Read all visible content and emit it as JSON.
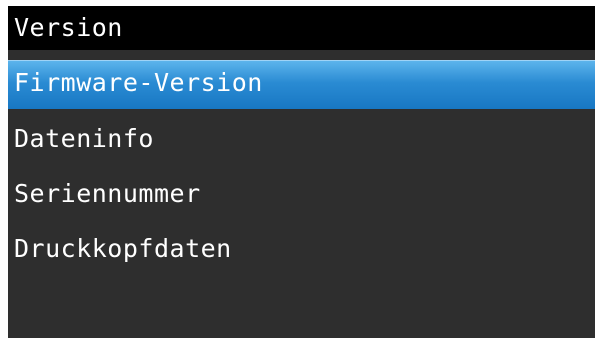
{
  "screen": {
    "title": "Version",
    "menu": {
      "selected_index": 0,
      "items": [
        {
          "label": "Firmware-Version"
        },
        {
          "label": "Dateninfo"
        },
        {
          "label": "Seriennummer"
        },
        {
          "label": "Druckkopfdaten"
        }
      ]
    }
  },
  "colors": {
    "screen_background": "#2e2e2e",
    "title_bar_background": "#000000",
    "selection_highlight": "#2a8bd3",
    "text": "#ffffff"
  }
}
